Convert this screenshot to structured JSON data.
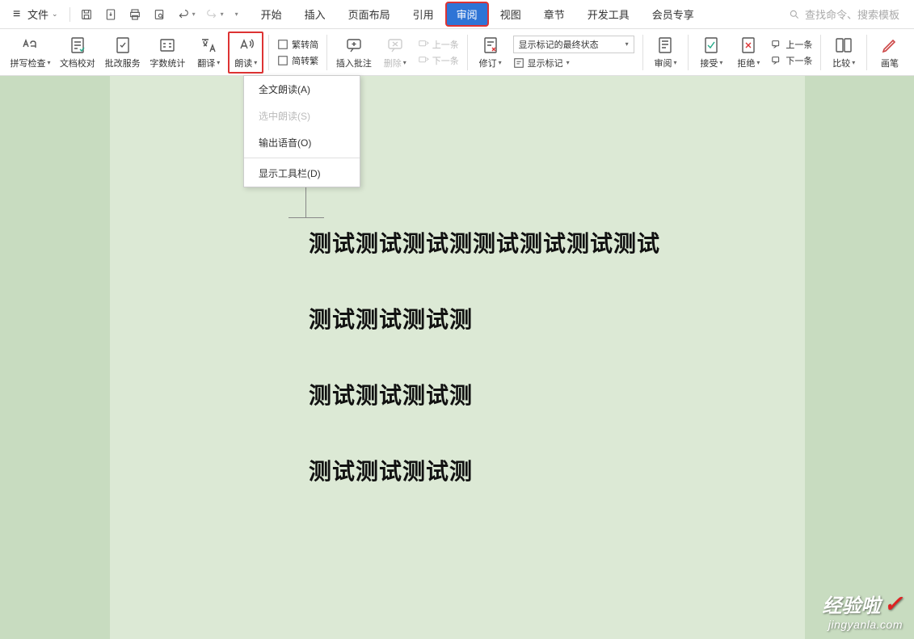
{
  "menubar": {
    "file": "文件",
    "search_placeholder": "查找命令、搜索模板"
  },
  "tabs": {
    "start": "开始",
    "insert": "插入",
    "layout": "页面布局",
    "reference": "引用",
    "review": "审阅",
    "view": "视图",
    "chapter": "章节",
    "dev": "开发工具",
    "member": "会员专享"
  },
  "ribbon": {
    "spellcheck": "拼写检查",
    "docproof": "文档校对",
    "approve": "批改服务",
    "wordcount": "字数统计",
    "translate": "翻译",
    "read": "朗读",
    "fan2jian": "繁转简",
    "jian2fan": "简转繁",
    "insertcomment": "插入批注",
    "delete": "删除",
    "prev": "上一条",
    "next": "下一条",
    "track": "修订",
    "markup_state": "显示标记的最终状态",
    "show_markup": "显示标记",
    "reviewpane": "审阅",
    "accept": "接受",
    "reject": "拒绝",
    "prev2": "上一条",
    "next2": "下一条",
    "compare": "比较",
    "pen": "画笔"
  },
  "dropdown": {
    "read_all": "全文朗读(A)",
    "read_sel": "选中朗读(S)",
    "output_audio": "输出语音(O)",
    "show_toolbar": "显示工具栏(D)"
  },
  "document": {
    "line1": "测试测试测试测测试测试测试测试",
    "line2": "测试测试测试测",
    "line3": "测试测试测试测",
    "line4": "测试测试测试测"
  },
  "watermark": {
    "top": "经验啦",
    "bottom": "jingyanla.com"
  }
}
